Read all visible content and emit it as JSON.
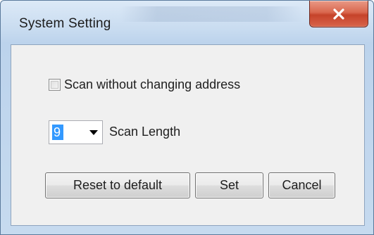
{
  "window": {
    "title": "System Setting",
    "close_icon": "close-icon"
  },
  "options": {
    "scan_without_changing_address": {
      "label": "Scan without changing address",
      "checked": false
    },
    "scan_length": {
      "value": "9",
      "label": "Scan Length"
    }
  },
  "buttons": {
    "reset": "Reset to default",
    "set": "Set",
    "cancel": "Cancel"
  },
  "colors": {
    "close_button": "#c6432a",
    "selection": "#3399ff"
  }
}
